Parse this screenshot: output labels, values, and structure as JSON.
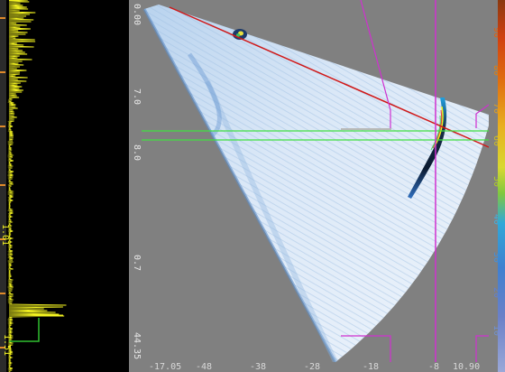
{
  "sidebar": {
    "depth_marks": [
      "1.01",
      "1.51"
    ]
  },
  "ruler_left": {
    "top": "0.00",
    "mid1": "7.0",
    "mid2": "8.0",
    "mid3": "0.7",
    "bottom": "44.35"
  },
  "color_scale": {
    "labels": [
      "90",
      "80",
      "70",
      "60",
      "50",
      "40",
      "30",
      "20",
      "10"
    ]
  },
  "bottom_axis": {
    "left_value": "-17.05",
    "right_value": "10.90",
    "ticks": [
      "-48",
      "-38",
      "-28",
      "-18",
      "-8"
    ]
  },
  "colors": {
    "cursor_vertical": "#d030d0",
    "cursor_horizontal": "#40e040",
    "reference_line": "#d01818",
    "ascan_trace": "#f2f220",
    "ascan_gate": "#30c030"
  }
}
